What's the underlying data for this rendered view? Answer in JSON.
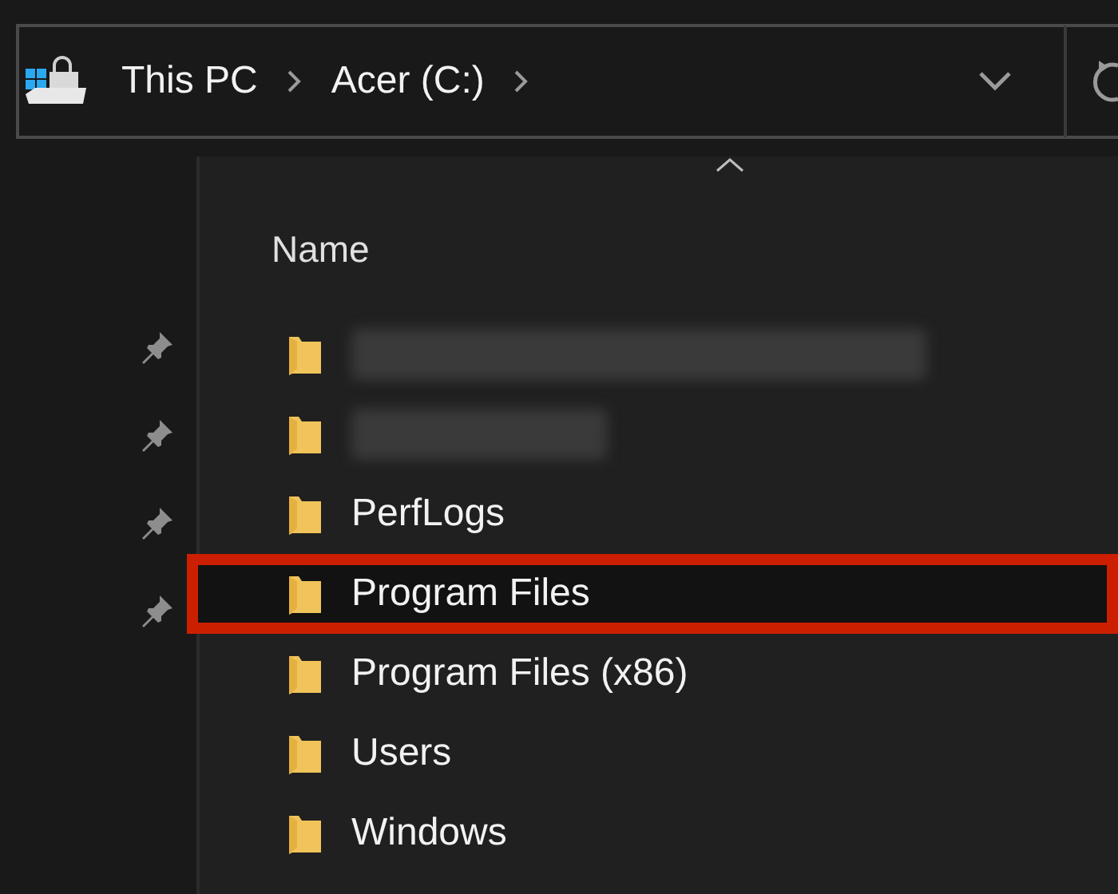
{
  "address_bar": {
    "crumbs": [
      "This PC",
      "Acer (C:)"
    ]
  },
  "file_list": {
    "column": "Name",
    "items": [
      {
        "kind": "blurred",
        "highlighted": false
      },
      {
        "kind": "blurred",
        "highlighted": false
      },
      {
        "kind": "folder",
        "name": "PerfLogs",
        "highlighted": false
      },
      {
        "kind": "folder",
        "name": "Program Files",
        "highlighted": true
      },
      {
        "kind": "folder",
        "name": "Program Files (x86)",
        "highlighted": false
      },
      {
        "kind": "folder",
        "name": "Users",
        "highlighted": false
      },
      {
        "kind": "folder",
        "name": "Windows",
        "highlighted": false
      }
    ]
  }
}
